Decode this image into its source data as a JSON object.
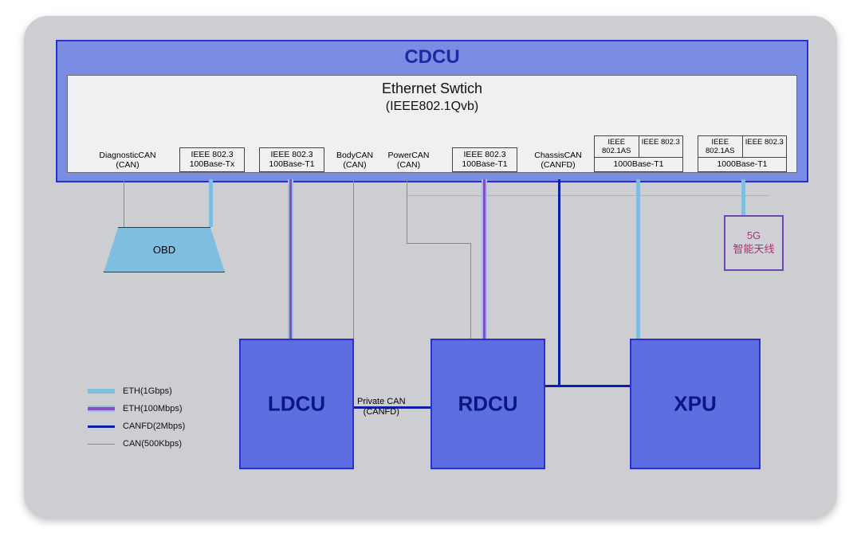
{
  "cdcu": {
    "title": "CDCU",
    "switch": {
      "title": "Ethernet Swtich",
      "subtitle": "(IEEE802.1Qvb)"
    },
    "ports": {
      "diag": {
        "l1": "DiagnosticCAN",
        "l2": "(CAN)"
      },
      "p8023a": {
        "l1": "IEEE 802.3",
        "l2": "100Base-Tx"
      },
      "p8023b": {
        "l1": "IEEE 802.3",
        "l2": "100Base-T1"
      },
      "body": {
        "l1": "BodyCAN",
        "l2": "(CAN)"
      },
      "power": {
        "l1": "PowerCAN",
        "l2": "(CAN)"
      },
      "p8023c": {
        "l1": "IEEE 802.3",
        "l2": "100Base-T1"
      },
      "chassis": {
        "l1": "ChassisCAN",
        "l2": "(CANFD)"
      },
      "pAS1": {
        "c1": "IEEE 802.1AS",
        "c2": "IEEE 802.3",
        "l2": "1000Base-T1"
      },
      "pAS2": {
        "c1": "IEEE 802.1AS",
        "c2": "IEEE 802.3",
        "l2": "1000Base-T1"
      }
    }
  },
  "blocks": {
    "ldcu": "LDCU",
    "rdcu": "RDCU",
    "xpu": "XPU",
    "obd": "OBD"
  },
  "fiveg": {
    "l1": "5G",
    "l2": "智能天线"
  },
  "private_can": {
    "l1": "Private CAN",
    "l2": "(CANFD)"
  },
  "legend": {
    "eth1g": "ETH(1Gbps)",
    "eth100": "ETH(100Mbps)",
    "canfd": "CANFD(2Mbps)",
    "can": "CAN(500Kbps)"
  },
  "colors": {
    "eth1g": "#7fbee0",
    "eth100": "#8a4dc0",
    "canfd": "#0b1fa8",
    "can": "#888888"
  }
}
